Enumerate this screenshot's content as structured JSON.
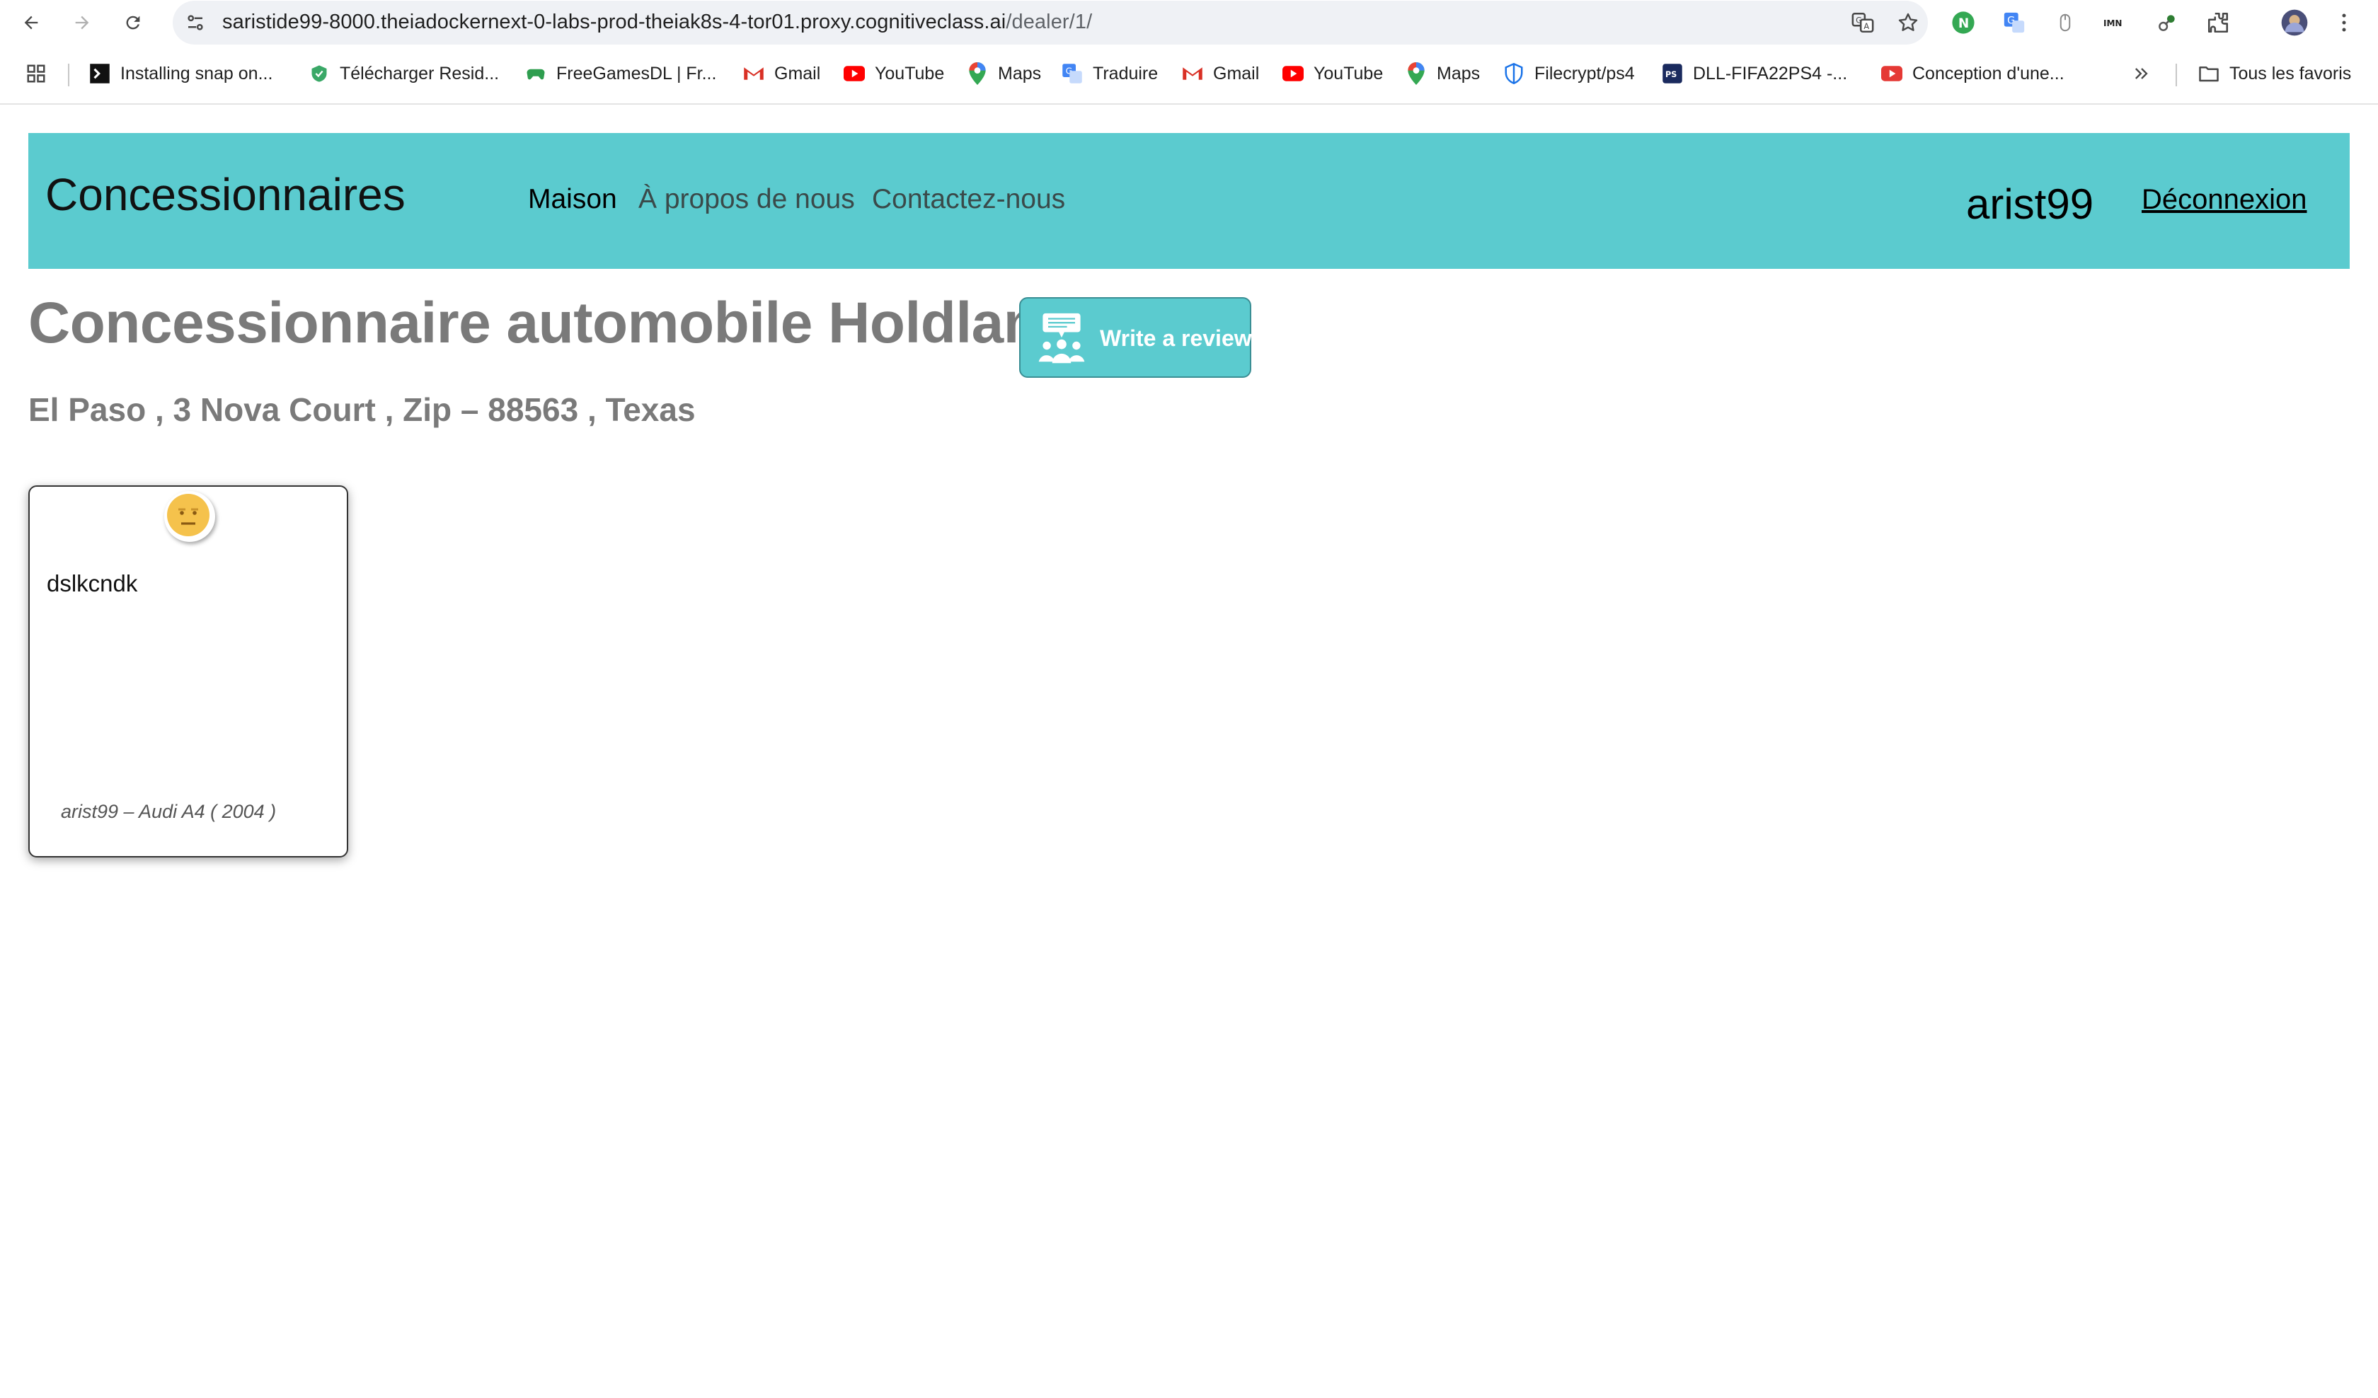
{
  "browser": {
    "url_host": "saristide99-8000.theiadockernext-0-labs-prod-theiak8s-4-tor01.proxy.cognitiveclass.ai",
    "url_path": "/dealer/1/",
    "bookmarks": [
      {
        "label": "Installing snap on...",
        "icon": "terminal-icon"
      },
      {
        "label": "Télécharger Resid...",
        "icon": "shield-green-icon"
      },
      {
        "label": "FreeGamesDL | Fr...",
        "icon": "gamepad-icon"
      },
      {
        "label": "Gmail",
        "icon": "gmail-icon"
      },
      {
        "label": "YouTube",
        "icon": "youtube-icon"
      },
      {
        "label": "Maps",
        "icon": "maps-icon"
      },
      {
        "label": "Traduire",
        "icon": "translate-icon"
      },
      {
        "label": "Gmail",
        "icon": "gmail-icon"
      },
      {
        "label": "YouTube",
        "icon": "youtube-icon"
      },
      {
        "label": "Maps",
        "icon": "maps-icon"
      },
      {
        "label": "Filecrypt/ps4",
        "icon": "shield-blue-icon"
      },
      {
        "label": "DLL-FIFA22PS4 -...",
        "icon": "ps-icon"
      },
      {
        "label": "Conception d'une...",
        "icon": "youtube-icon"
      }
    ],
    "all_bookmarks_label": "Tous les favoris"
  },
  "navbar": {
    "brand": "Concessionnaires",
    "links": [
      "Maison",
      "À propos de nous",
      "Contactez-nous"
    ],
    "username": "arist99",
    "logout": "Déconnexion"
  },
  "dealer": {
    "title": "Concessionnaire automobile Holdlamis",
    "write_review": "Write a review",
    "address": "El Paso , 3 Nova Court , Zip – 88563 , Texas"
  },
  "reviews": [
    {
      "text": "dslkcndk",
      "meta": "arist99 – Audi A4 ( 2004 )",
      "sentiment_icon": "neutral-face-icon"
    }
  ],
  "colors": {
    "navbar": "#5bcbcf",
    "heading": "#7a7a7a"
  }
}
